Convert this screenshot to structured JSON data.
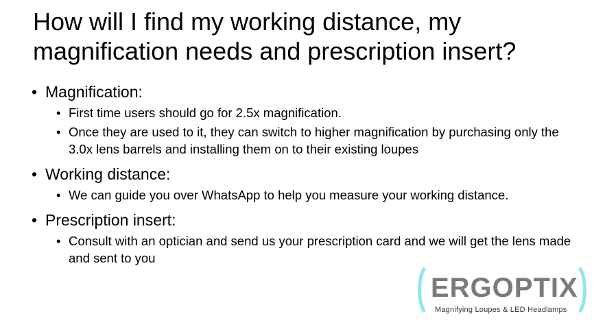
{
  "title": "How will I find my working distance, my magnification needs and prescription insert?",
  "sections": [
    {
      "heading": "Magnification:",
      "items": [
        "First time users should go for 2.5x magnification.",
        "Once they are used to it, they can switch to higher magnification by purchasing only the 3.0x lens barrels and installing them on to their existing loupes"
      ]
    },
    {
      "heading": "Working distance:",
      "items": [
        "We can guide you over WhatsApp to help you measure your working distance."
      ]
    },
    {
      "heading": "Prescription insert:",
      "items": [
        "Consult with an optician and send us your prescription card and we will get the lens made and sent to you"
      ]
    }
  ],
  "logo": {
    "name": "ERGOPTIX",
    "tagline": "Magnifying Loupes & LED Headlamps",
    "accent_color": "#8fe6ee",
    "text_color": "#7a7a7a"
  }
}
